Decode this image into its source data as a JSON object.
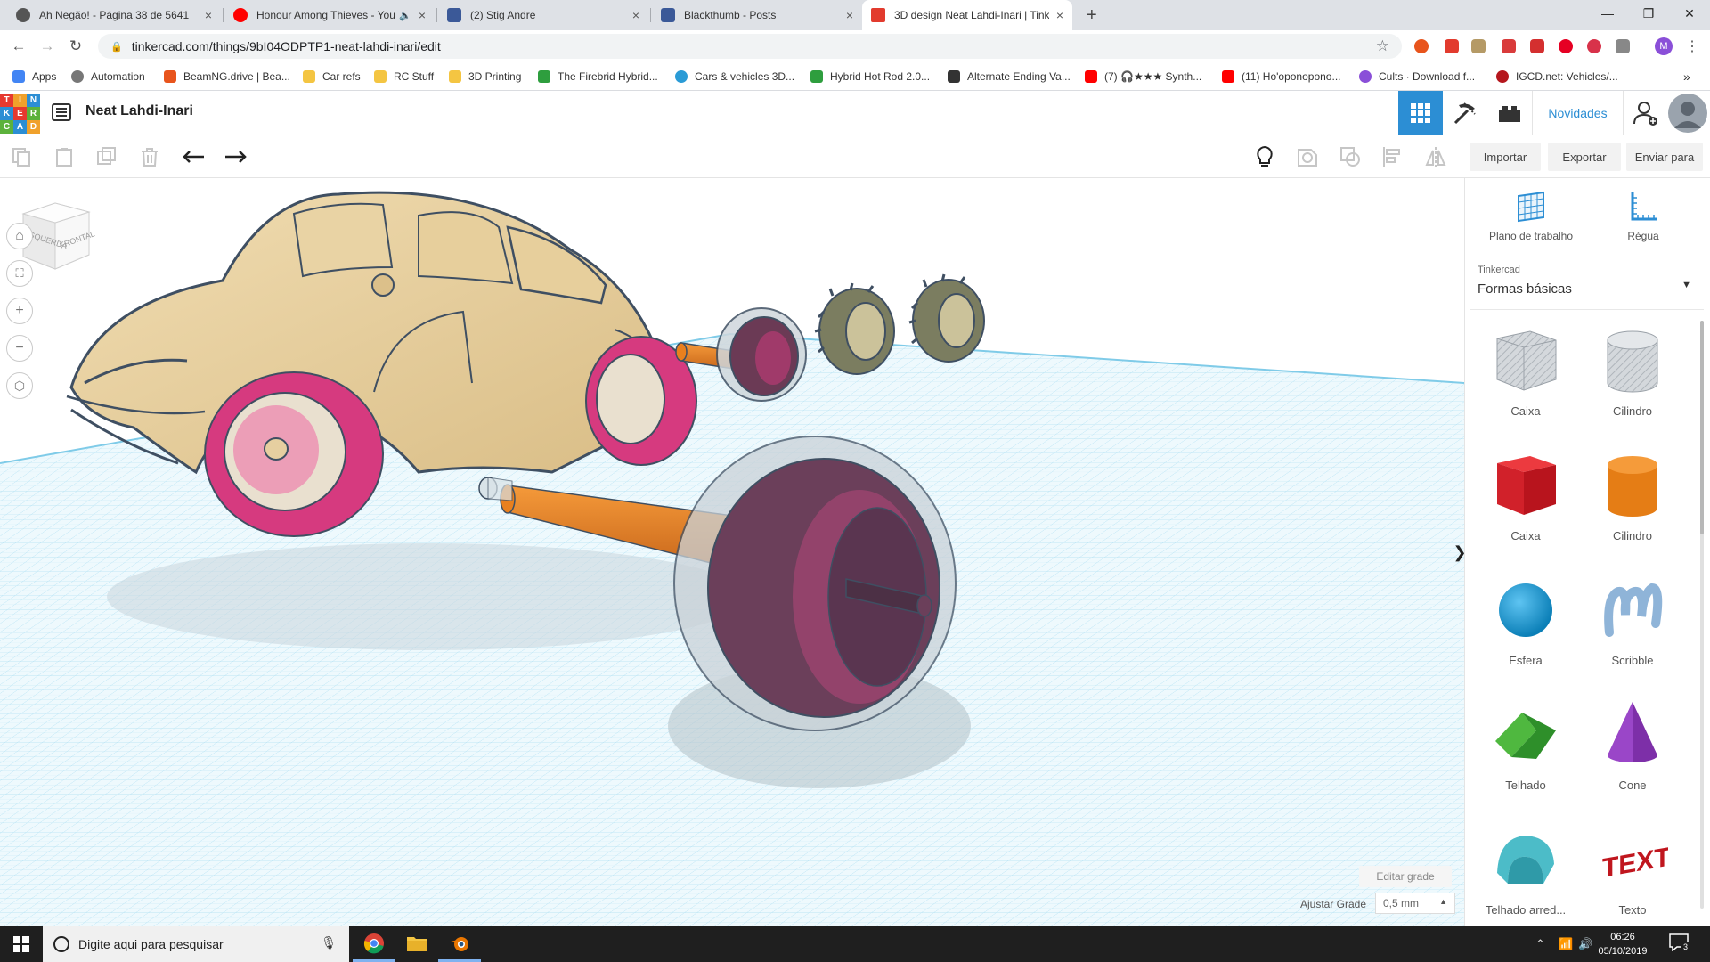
{
  "browser": {
    "tabs": [
      {
        "title": "Ah Negão! - Página 38 de 5641",
        "icon_color": "#555555",
        "close": "×"
      },
      {
        "title": "Honour Among Thieves - You",
        "icon_color": "#ff0000",
        "close": "×"
      },
      {
        "title": "(2) Stig Andre",
        "icon_color": "#3b5998",
        "close": "×"
      },
      {
        "title": "Blackthumb - Posts",
        "icon_color": "#3b5998",
        "close": "×"
      },
      {
        "title": "3D design Neat Lahdi-Inari | Tink",
        "icon_color": "#e23b2e",
        "close": "×"
      }
    ],
    "new_tab": "+",
    "window_controls": {
      "minimize": "—",
      "maximize": "❐",
      "close": "✕"
    },
    "url": "tinkercad.com/things/9bI04ODPTP1-neat-lahdi-inari/edit",
    "bookmarks": [
      {
        "label": "Apps",
        "icon_color": "#4285f4"
      },
      {
        "label": "Automation",
        "icon_color": "#777777"
      },
      {
        "label": "BeamNG.drive | Bea...",
        "icon_color": "#e8541c"
      },
      {
        "label": "Car refs",
        "icon_color": "#f4c542"
      },
      {
        "label": "RC Stuff",
        "icon_color": "#f4c542"
      },
      {
        "label": "3D Printing",
        "icon_color": "#f4c542"
      },
      {
        "label": "The Firebrid Hybrid...",
        "icon_color": "#2e9e3e"
      },
      {
        "label": "Cars & vehicles 3D...",
        "icon_color": "#2a9bd6"
      },
      {
        "label": "Hybrid Hot Rod 2.0...",
        "icon_color": "#2e9e3e"
      },
      {
        "label": "Alternate Ending Va...",
        "icon_color": "#333333"
      },
      {
        "label": "(7) 🎧★★★ Synth...",
        "icon_color": "#ff0000"
      },
      {
        "label": "(11) Ho'oponopono...",
        "icon_color": "#ff0000"
      },
      {
        "label": "Cults · Download f...",
        "icon_color": "#8a4fd8"
      },
      {
        "label": "IGCD.net: Vehicles/...",
        "icon_color": "#b5171d"
      }
    ],
    "bookmarks_more": "»"
  },
  "app": {
    "logo_letters": [
      "T",
      "I",
      "N",
      "K",
      "E",
      "R",
      "C",
      "A",
      "D"
    ],
    "design_name": "Neat Lahdi-Inari",
    "novidades": "Novidades",
    "actions": {
      "import": "Importar",
      "export": "Exportar",
      "send": "Enviar para"
    },
    "viewcube": {
      "left": "ESQUERDA",
      "front": "FRONTAL"
    },
    "edit_grid": "Editar grade",
    "snap_label": "Ajustar Grade",
    "snap_value": "0,5 mm",
    "panel_toggle": "❯",
    "workplane": "Plano de trabalho",
    "ruler": "Régua",
    "library_category": "Tinkercad",
    "library_name": "Formas básicas",
    "shapes": [
      {
        "label": "Caixa",
        "icon": "box-hole-icon"
      },
      {
        "label": "Cilindro",
        "icon": "cylinder-hole-icon"
      },
      {
        "label": "Caixa",
        "icon": "box-icon"
      },
      {
        "label": "Cilindro",
        "icon": "cylinder-icon"
      },
      {
        "label": "Esfera",
        "icon": "sphere-icon"
      },
      {
        "label": "Scribble",
        "icon": "scribble-icon"
      },
      {
        "label": "Telhado",
        "icon": "roof-icon"
      },
      {
        "label": "Cone",
        "icon": "cone-icon"
      },
      {
        "label": "Telhado arred...",
        "icon": "round-roof-icon"
      },
      {
        "label": "Texto",
        "icon": "text-icon"
      }
    ],
    "colors": {
      "accent": "#2c8ed4",
      "grid": "#bfe6f6",
      "car": "#e6cfa0",
      "wheel": "#e0458a",
      "axle": "#e9801e"
    }
  },
  "taskbar": {
    "search_placeholder": "Digite aqui para pesquisar",
    "time": "06:26",
    "date": "05/10/2019",
    "notifications": "3"
  }
}
